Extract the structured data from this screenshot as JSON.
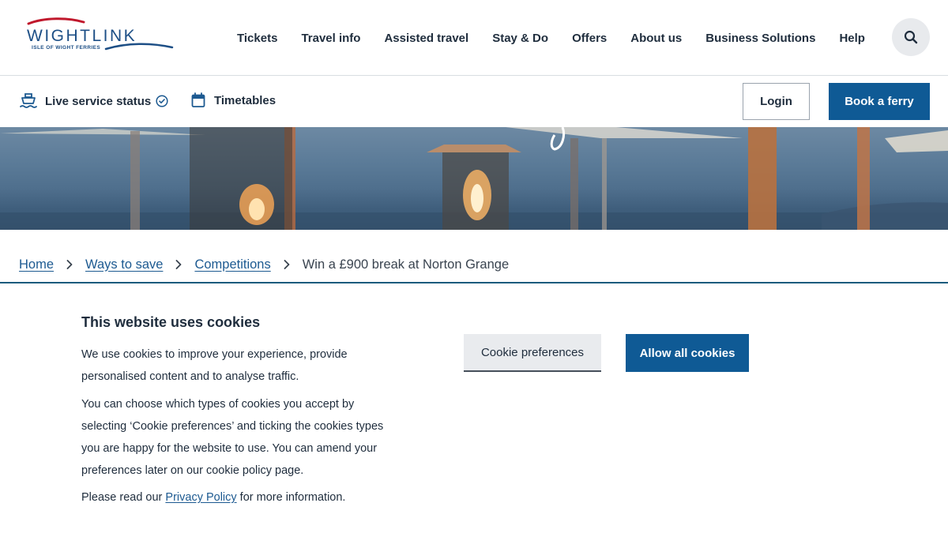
{
  "brand": {
    "name": "WIGHTLINK",
    "tagline": "ISLE OF WIGHT FERRIES",
    "primary_color": "#0f5a95",
    "accent_color": "#c0182c"
  },
  "nav": {
    "items": [
      {
        "label": "Tickets"
      },
      {
        "label": "Travel info"
      },
      {
        "label": "Assisted travel"
      },
      {
        "label": "Stay & Do"
      },
      {
        "label": "Offers"
      },
      {
        "label": "About us"
      },
      {
        "label": "Business Solutions"
      },
      {
        "label": "Help"
      }
    ],
    "search_icon": "search-icon"
  },
  "subnav": {
    "live_status": {
      "label": "Live service status",
      "icon": "ferry-icon",
      "status_icon": "check-circle-icon"
    },
    "timetables": {
      "label": "Timetables",
      "icon": "calendar-icon"
    },
    "login_label": "Login",
    "book_label": "Book a ferry"
  },
  "breadcrumb": {
    "items": [
      {
        "label": "Home"
      },
      {
        "label": "Ways to save"
      },
      {
        "label": "Competitions"
      }
    ],
    "current": "Win a £900 break at Norton Grange"
  },
  "cookie": {
    "title": "This website uses cookies",
    "para1": "We use cookies to improve your experience, provide personalised content and to analyse traffic.",
    "para2": "You can choose which types of cookies you accept by selecting ‘Cookie preferences’ and ticking the cookies types you are happy for the website to use. You can amend your preferences later on our cookie policy page.",
    "para3_before": "Please read our ",
    "para3_link": "Privacy Policy",
    "para3_after": " for more information.",
    "preferences_label": "Cookie preferences",
    "allow_label": "Allow all cookies"
  }
}
